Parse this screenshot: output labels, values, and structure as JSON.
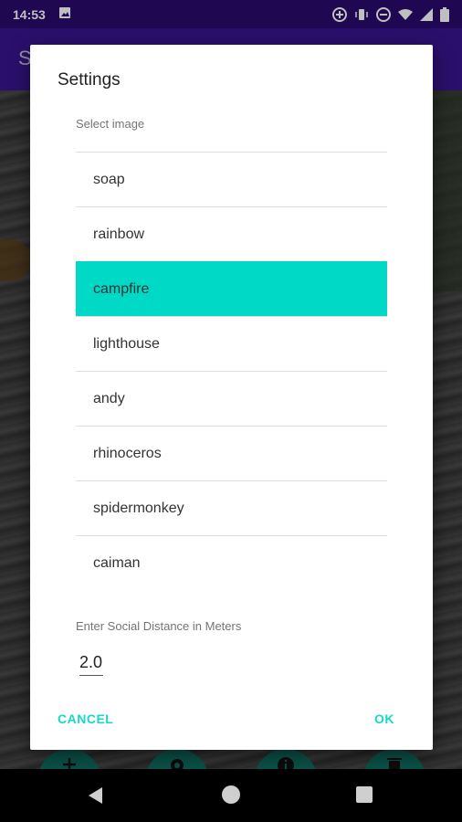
{
  "status_bar": {
    "time": "14:53",
    "icons": [
      "image-icon",
      "add-circle-icon",
      "vibrate-icon",
      "do-not-disturb-icon",
      "wifi-icon",
      "signal-icon",
      "battery-icon"
    ]
  },
  "app_bar": {
    "title_fragment": "S"
  },
  "dialog": {
    "title": "Settings",
    "image_section_label": "Select image",
    "images": [
      "soap",
      "rainbow",
      "campfire",
      "lighthouse",
      "andy",
      "rhinoceros",
      "spidermonkey",
      "caiman"
    ],
    "selected_image": "campfire",
    "distance_label": "Enter Social Distance in Meters",
    "distance_value": "2.0",
    "cancel_label": "CANCEL",
    "ok_label": "OK"
  },
  "fabs": [
    "add-icon",
    "gear-icon",
    "info-icon",
    "trash-icon"
  ],
  "colors": {
    "status_bar": "#2a0a6e",
    "app_bar": "#3a1490",
    "accent": "#17d9c5",
    "selected_row": "#00d9c6"
  },
  "nav_bar": {
    "icons": [
      "back-icon",
      "home-icon",
      "recents-icon"
    ]
  }
}
